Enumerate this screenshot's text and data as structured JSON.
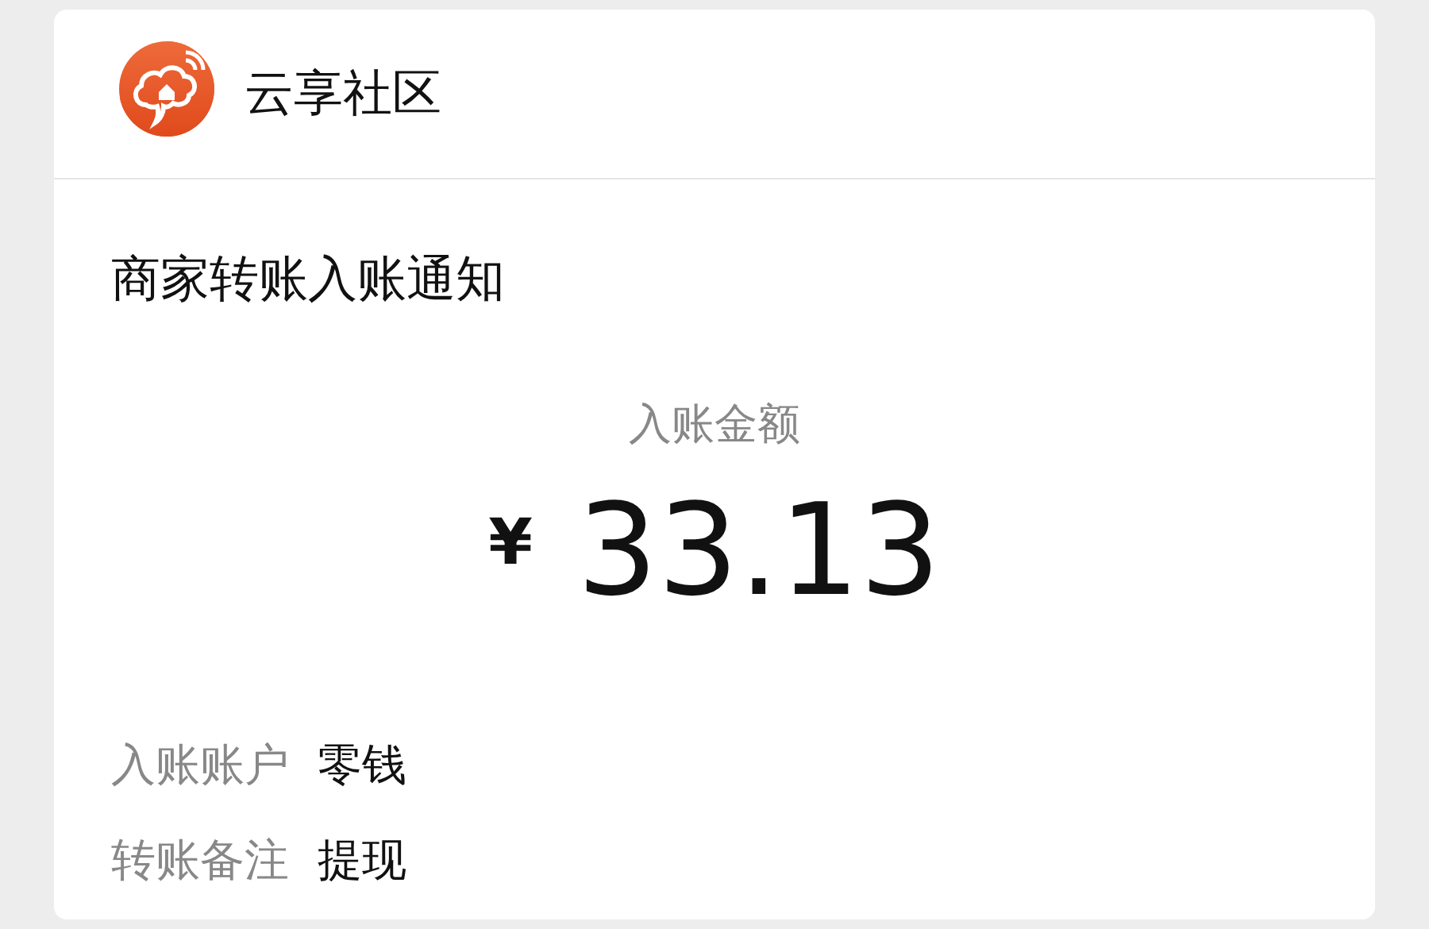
{
  "account": {
    "name": "云享社区"
  },
  "notice": {
    "title": "商家转账入账通知",
    "amount_label": "入账金额",
    "currency": "¥",
    "amount": "33.13",
    "details": [
      {
        "label": "入账账户",
        "value": "零钱"
      },
      {
        "label": "转账备注",
        "value": "提现"
      }
    ]
  }
}
